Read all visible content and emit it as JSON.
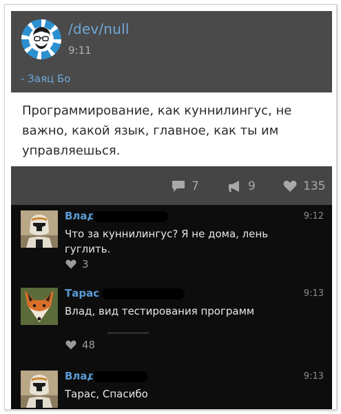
{
  "post": {
    "channel": "/dev/null",
    "time": "9:11",
    "signature": "- Заяц Бо",
    "text": "Программирование, как куннилингус, не важно, какой язык, главное, как ты им управляешься."
  },
  "actions": {
    "comments_count": "7",
    "reposts_count": "9",
    "likes_count": "135"
  },
  "comments": [
    {
      "name": "Влад",
      "time": "9:12",
      "text": "Что за куннилингус? Я не дома, лень гуглить.",
      "likes": "3"
    },
    {
      "name": "Тарас",
      "time": "9:13",
      "text": "Влад, вид тестирования программ",
      "likes": "48"
    },
    {
      "name": "Влад",
      "time": "9:13",
      "text": "Тарас, Спасибо"
    }
  ],
  "colors": {
    "accent_link": "#6fa8d8",
    "comment_name": "#5a9bd6",
    "header_bg": "#4a4a4a",
    "comments_bg": "#0d0d0d"
  }
}
